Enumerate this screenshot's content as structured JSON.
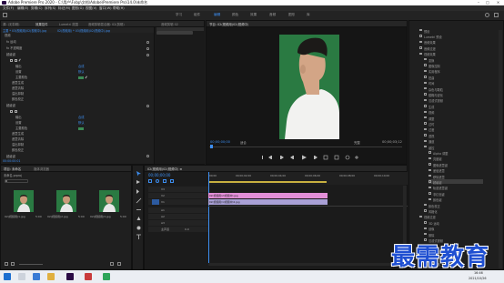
{
  "titlebar": {
    "title": "Adobe Premiere Pro 2020 - C:\\用户\\Fxbp\\文档\\Adobe\\Premiere Pro\\14.0\\未命名"
  },
  "menubar": [
    "文件(F)",
    "编辑(E)",
    "剪辑(C)",
    "序列(S)",
    "标记(M)",
    "图形(G)",
    "视图(V)",
    "窗口(W)",
    "帮助(H)"
  ],
  "workspaces": [
    "学习",
    "组件",
    "编辑",
    "颜色",
    "效果",
    "音频",
    "图形",
    "库"
  ],
  "effect_controls": {
    "tabs": [
      "源: (无剪辑)",
      "效果控件",
      "Lumetri 范围",
      "音频剪辑混合器: 02(剪辑)",
      "音频剪辑 02"
    ],
    "header_master": "主要 * 03(视频用)02(视频中).jpg",
    "header_clip": "02(视频用) * 03(视频用)02(视频中).jpg",
    "rows": [
      "视频",
      "fx 运动",
      "fx 不透明度",
      "超级键",
      "",
      "输出",
      "设置",
      "主要颜色",
      "遮罩生成",
      "遮罩清除",
      "溢出抑制",
      "颜色校正",
      "超级键",
      "",
      "输出",
      "设置",
      "主要颜色",
      "遮罩生成",
      "遮罩清除",
      "溢出抑制",
      "颜色校正",
      "超级键"
    ],
    "output_value": "合成",
    "setting_value": "默认",
    "timecode": "00:00:00:01"
  },
  "program_monitor": {
    "tab": "节目: 02(视频用)02(视频中)",
    "timecode_left": "00;00;00;00",
    "fit_label": "适合",
    "quality_label": "完整",
    "timecode_right": "00;00;03;12"
  },
  "project_panel": {
    "tabs": [
      "项目: 未命名",
      "媒体浏览器"
    ],
    "path": "未命名.prproj",
    "search_placeholder": "",
    "items": [
      {
        "name": "02(视频用)1.jpg",
        "duration": "5:00"
      },
      {
        "name": "02(视频用)2.jpg",
        "duration": "5:00"
      },
      {
        "name": "02(视频用)3.jpg",
        "duration": "5:00"
      }
    ]
  },
  "timeline": {
    "tab": "02(视频用)02(视频中) ≡",
    "timecode": "00;00;00;00",
    "ruler": [
      "00;00",
      "00;00;02;00",
      "00;00;04;00",
      "00;00;06;00",
      "00;00;08;00",
      "00;00;10;00"
    ],
    "tracks": [
      "V3",
      "V2",
      "V1",
      "A1",
      "A2",
      "A3"
    ],
    "master_label": "主声道",
    "master_value": "0.0",
    "clips": {
      "v2": "02(视频用)2(视频中).jpg",
      "v1": "02(视频用)1(视频中)2.jpg"
    }
  },
  "effects_tree": {
    "items": [
      "预设",
      "Lumetri 预设",
      "音频效果",
      "音频过渡",
      "视频效果",
      "变换",
      "图像控制",
      "实用程序",
      "扭曲",
      "时间",
      "杂色与颗粒",
      "模糊与锐化",
      "沉浸式视频",
      "生成",
      "视频",
      "调整",
      "过时",
      "过渡",
      "透视",
      "通道",
      "键控",
      "Alpha 调整",
      "亮度键",
      "图像遮罩键",
      "差值遮罩",
      "移除遮罩",
      "超级键",
      "轨道遮罩键",
      "非红色键",
      "颜色键",
      "颜色校正",
      "风格化",
      "视频过渡",
      "3D 运动",
      "划像",
      "擦除",
      "沉浸式视频",
      "溶解",
      "滑动",
      "缩放",
      "页面剥落"
    ]
  },
  "watermark": {
    "text": "最需教育"
  },
  "taskbar": {
    "time": "16:46",
    "date": "2021/10/26"
  }
}
